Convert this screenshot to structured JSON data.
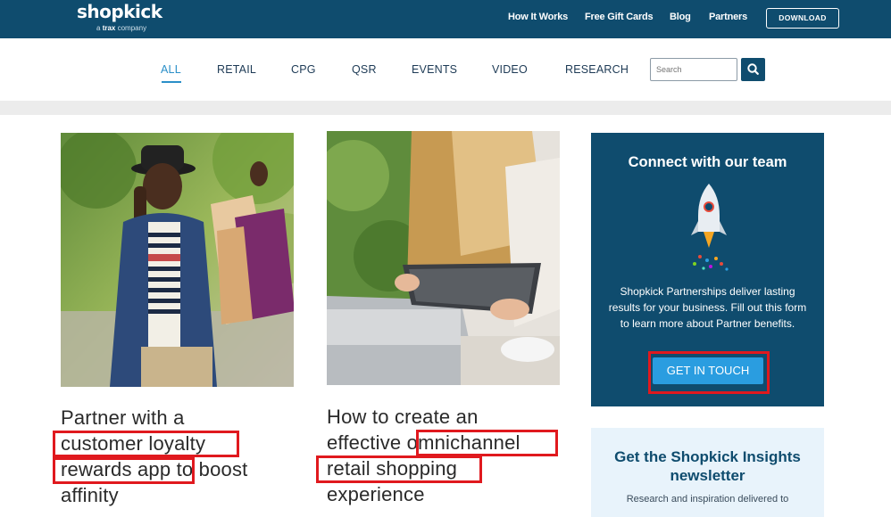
{
  "header": {
    "logo_word": "shopkick",
    "logo_sub_prefix": "a",
    "logo_sub_brand": "trax",
    "logo_sub_suffix": "company",
    "links": [
      "How It Works",
      "Free Gift Cards",
      "Blog",
      "Partners"
    ],
    "download_label": "DOWNLOAD"
  },
  "categories": [
    "ALL",
    "RETAIL",
    "CPG",
    "QSR",
    "EVENTS",
    "VIDEO",
    "RESEARCH"
  ],
  "active_category": "ALL",
  "search": {
    "placeholder": "Search"
  },
  "articles": [
    {
      "title_lines": [
        "Partner with a",
        "customer loyalty",
        "rewards app to boost",
        "affinity"
      ]
    },
    {
      "title_lines": [
        "How to create an",
        "effective omnichannel",
        "retail shopping",
        "experience"
      ]
    }
  ],
  "sidebar": {
    "connect_title": "Connect with our team",
    "connect_body": "Shopkick Partnerships deliver lasting results for your business. Fill out this form to learn more about Partner benefits.",
    "cta_label": "GET IN TOUCH",
    "newsletter_title": "Get the Shopkick Insights newsletter",
    "newsletter_sub": "Research and inspiration delivered to"
  },
  "colors": {
    "brand_navy": "#0f4c6e",
    "accent_blue": "#2a9de0",
    "highlight_red": "#e0191e"
  }
}
